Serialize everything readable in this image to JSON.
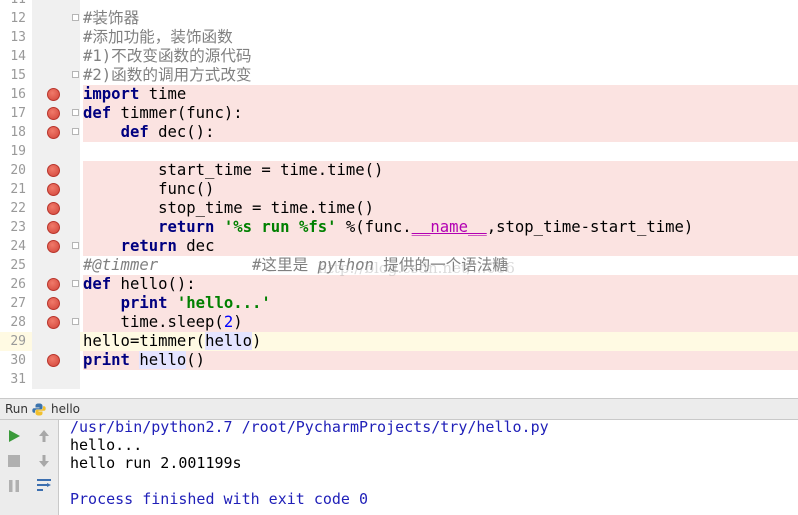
{
  "editor": {
    "lines": [
      {
        "no": "11",
        "bp": false,
        "fold": false,
        "tokens": [
          {
            "t": "'''",
            "c": "cmtz"
          }
        ]
      },
      {
        "no": "12",
        "bp": false,
        "fold": true,
        "tokens": [
          {
            "t": "#装饰器",
            "c": "cmtz"
          }
        ]
      },
      {
        "no": "13",
        "bp": false,
        "fold": false,
        "tokens": [
          {
            "t": "#添加功能，装饰函数",
            "c": "cmtz"
          }
        ]
      },
      {
        "no": "14",
        "bp": false,
        "fold": false,
        "tokens": [
          {
            "t": "#1)不改变函数的源代码",
            "c": "cmtz"
          }
        ]
      },
      {
        "no": "15",
        "bp": false,
        "fold": true,
        "tokens": [
          {
            "t": "#2)函数的调用方式改变",
            "c": "cmtz"
          }
        ]
      },
      {
        "no": "16",
        "bp": true,
        "fold": false,
        "tokens": [
          {
            "t": "import",
            "c": "kw"
          },
          {
            "t": " time",
            "c": ""
          }
        ]
      },
      {
        "no": "17",
        "bp": true,
        "fold": true,
        "tokens": [
          {
            "t": "def",
            "c": "kw"
          },
          {
            "t": " timmer(func):",
            "c": ""
          }
        ]
      },
      {
        "no": "18",
        "bp": true,
        "fold": true,
        "tokens": [
          {
            "t": "    ",
            "c": ""
          },
          {
            "t": "def",
            "c": "kw"
          },
          {
            "t": " dec():",
            "c": ""
          }
        ]
      },
      {
        "no": "19",
        "bp": false,
        "fold": false,
        "tokens": []
      },
      {
        "no": "20",
        "bp": true,
        "fold": false,
        "tokens": [
          {
            "t": "        start_time = time.time()",
            "c": ""
          }
        ]
      },
      {
        "no": "21",
        "bp": true,
        "fold": false,
        "tokens": [
          {
            "t": "        func()",
            "c": ""
          }
        ]
      },
      {
        "no": "22",
        "bp": true,
        "fold": false,
        "tokens": [
          {
            "t": "        stop_time = time.time()",
            "c": ""
          }
        ]
      },
      {
        "no": "23",
        "bp": true,
        "fold": false,
        "tokens": [
          {
            "t": "        ",
            "c": ""
          },
          {
            "t": "return",
            "c": "kw"
          },
          {
            "t": " ",
            "c": ""
          },
          {
            "t": "'%s run %fs'",
            "c": "str"
          },
          {
            "t": " %(func.",
            "c": ""
          },
          {
            "t": "__name__",
            "c": "magic"
          },
          {
            "t": ",stop_time-start_time)",
            "c": ""
          }
        ]
      },
      {
        "no": "24",
        "bp": true,
        "fold": true,
        "tokens": [
          {
            "t": "    ",
            "c": ""
          },
          {
            "t": "return",
            "c": "kw"
          },
          {
            "t": " dec",
            "c": ""
          }
        ]
      },
      {
        "no": "25",
        "bp": false,
        "fold": false,
        "tokens": [
          {
            "t": "#@timmer",
            "c": "cmt"
          },
          {
            "t": "          #这里是 ",
            "c": "cmtz"
          },
          {
            "t": "python",
            "c": "cmt"
          },
          {
            "t": " 提供的一个语法糖",
            "c": "cmtz"
          }
        ]
      },
      {
        "no": "26",
        "bp": true,
        "fold": true,
        "tokens": [
          {
            "t": "def",
            "c": "kw"
          },
          {
            "t": " hello():",
            "c": ""
          }
        ]
      },
      {
        "no": "27",
        "bp": true,
        "fold": false,
        "tokens": [
          {
            "t": "    ",
            "c": ""
          },
          {
            "t": "print",
            "c": "kw"
          },
          {
            "t": " ",
            "c": ""
          },
          {
            "t": "'hello...'",
            "c": "str"
          }
        ]
      },
      {
        "no": "28",
        "bp": true,
        "fold": true,
        "bulb": true,
        "tokens": [
          {
            "t": "    time.sleep(",
            "c": ""
          },
          {
            "t": "2",
            "c": "num"
          },
          {
            "t": ")",
            "c": ""
          }
        ]
      },
      {
        "no": "29",
        "bp": false,
        "fold": false,
        "caret": true,
        "tokens": [
          {
            "t": "hello=timmer(",
            "c": ""
          },
          {
            "t": "hello",
            "c": "hl"
          },
          {
            "t": ")",
            "c": ""
          }
        ]
      },
      {
        "no": "30",
        "bp": true,
        "fold": false,
        "tokens": [
          {
            "t": "print",
            "c": "kw"
          },
          {
            "t": " ",
            "c": ""
          },
          {
            "t": "hello",
            "c": "hl"
          },
          {
            "t": "()",
            "c": ""
          }
        ]
      },
      {
        "no": "31",
        "bp": false,
        "fold": false,
        "tokens": []
      }
    ],
    "watermark": "http://blog.csdn.net/...066",
    "bulb_icon": "lightbulb-icon",
    "breakpoint_color": "#d2453a"
  },
  "run_panel": {
    "title": "Run",
    "config_name": "hello",
    "config_icon": "python-icon",
    "toolbar": [
      {
        "name": "rerun-icon",
        "glyph": "▶",
        "color": "#3a9a3a"
      },
      {
        "name": "stop-icon",
        "glyph": "■",
        "color": "#b0b0b0"
      },
      {
        "name": "pause-icon",
        "glyph": "❚❚",
        "color": "#b0b0b0"
      },
      {
        "name": "up-arrow-icon",
        "glyph": "↑",
        "color": "#a0a0a0"
      },
      {
        "name": "down-arrow-icon",
        "glyph": "↓",
        "color": "#a0a0a0"
      },
      {
        "name": "soft-wrap-icon",
        "glyph": "⇆",
        "color": "#3c6fb0"
      }
    ],
    "console": [
      {
        "text": "/usr/bin/python2.7 /root/PycharmProjects/try/hello.py",
        "color": "#1f1fb8"
      },
      {
        "text": "hello...",
        "color": "#000000"
      },
      {
        "text": "hello run 2.001199s",
        "color": "#000000"
      },
      {
        "text": "",
        "color": "#000000"
      },
      {
        "text": "Process finished with exit code 0",
        "color": "#1f1fb8"
      }
    ]
  }
}
